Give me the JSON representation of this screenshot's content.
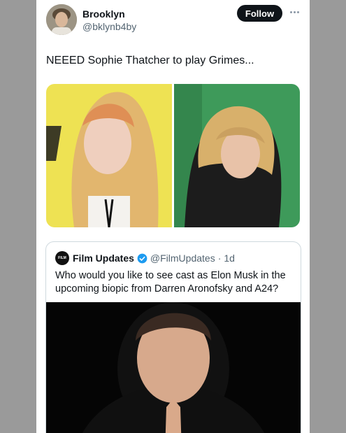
{
  "tweet": {
    "author_name": "Brooklyn",
    "author_handle": "@bklynb4by",
    "follow_label": "Follow",
    "text": "NEEED Sophie Thatcher to play Grimes..."
  },
  "quoted_tweet": {
    "author_name": "Film Updates",
    "author_handle": "@FilmUpdates",
    "separator": "·",
    "time": "1d",
    "text": "Who would you like to see cast as Elon Musk in the upcoming biopic from Darren Aronofsky and A24?"
  },
  "colors": {
    "follow_bg": "#0f1419",
    "verified": "#1d9bf0",
    "page_bg": "#9a9a9a"
  }
}
